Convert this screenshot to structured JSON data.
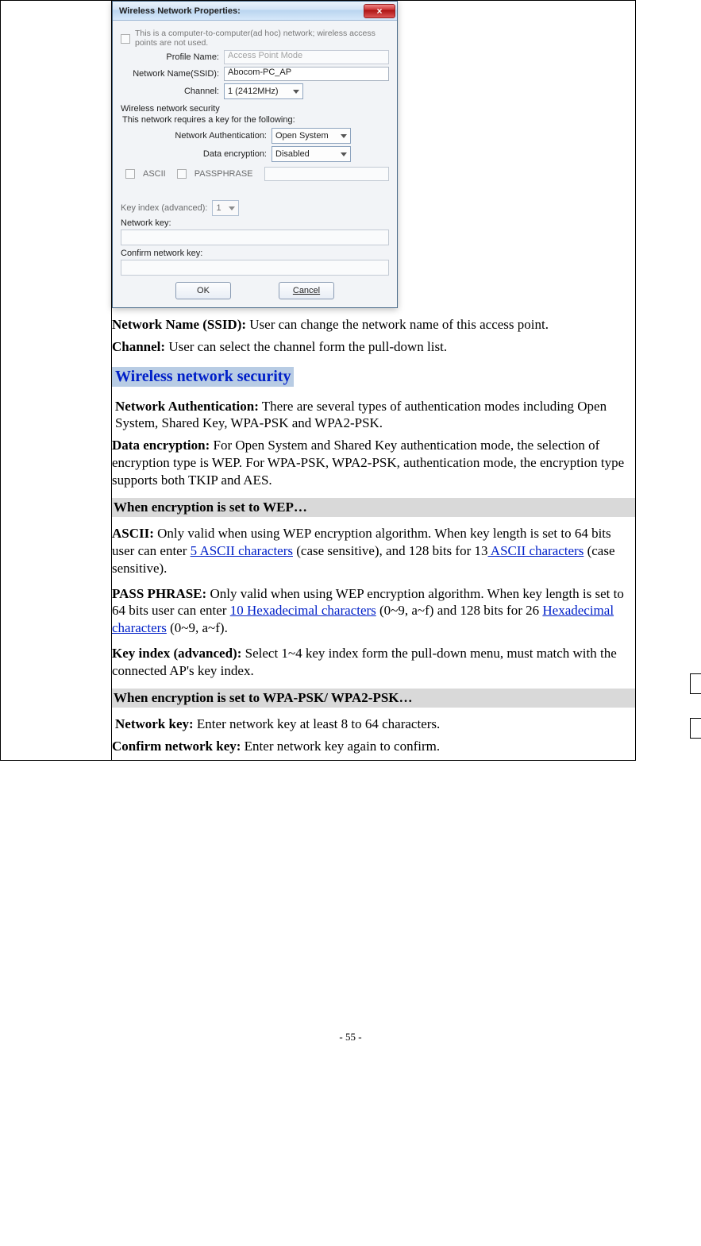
{
  "dialog": {
    "title": "Wireless Network Properties:",
    "adhoc_label": "This is a computer-to-computer(ad hoc) network; wireless access points are not used.",
    "profile_name_label": "Profile Name:",
    "profile_name_value": "Access Point Mode",
    "ssid_label": "Network Name(SSID):",
    "ssid_value": "Abocom-PC_AP",
    "channel_label": "Channel:",
    "channel_value": "1 (2412MHz)",
    "sec_group": "Wireless network security",
    "sec_sub": "This network requires a key for the following:",
    "auth_label": "Network Authentication:",
    "auth_value": "Open System",
    "enc_label": "Data encryption:",
    "enc_value": "Disabled",
    "ascii_label": "ASCII",
    "pass_label": "PASSPHRASE",
    "keyidx_label": "Key index (advanced):",
    "keyidx_value": "1",
    "netkey_label": "Network key:",
    "confirmkey_label": "Confirm network key:",
    "ok": "OK",
    "cancel": "Cancel"
  },
  "doc": {
    "ssid_b": "Network Name (SSID):",
    "ssid_t": " User can change the network name of this access point.",
    "channel_b": "Channel:",
    "channel_t": " User can select the channel form the pull-down list.",
    "sect_sec": "Wireless network security",
    "auth_b": "Network Authentication:",
    "auth_t": " There are several types of authentication modes including Open System, Shared Key, WPA-PSK and WPA2-PSK.",
    "enc_b": "Data encryption:",
    "enc_t": " For Open System and Shared Key authentication mode, the selection of encryption type is WEP. For WPA-PSK, WPA2-PSK, authentication mode, the encryption type supports both TKIP and AES.",
    "wep_h": "When encryption is set to WEP…",
    "ascii_b": "ASCII:",
    "ascii_t1": " Only valid when using WEP encryption algorithm. When key length is set to 64 bits user can enter ",
    "ascii_l1": "5 ASCII characters",
    "ascii_t2": " (case sensitive), and 128 bits for 13",
    "ascii_l2": " ASCII characters",
    "ascii_t3": " (case sensitive).",
    "pass_b": "PASS PHRASE:",
    "pass_t1": " Only valid when using WEP encryption algorithm. When key length is set to 64 bits user can enter ",
    "pass_l1": "10 Hexadecimal characters",
    "pass_t2": " (0~9, a~f) and 128 bits for 26 ",
    "pass_l2": "Hexadecimal characters",
    "pass_t3": " (0~9, a~f).",
    "kidx_b": "Key index (advanced):",
    "kidx_t": " Select 1~4 key index form the pull-down menu, must match with the connected AP's key index.",
    "wpa_h": "When encryption is set to WPA-PSK/ WPA2-PSK…",
    "nkey_b": "Network key:",
    "nkey_t": " Enter network key at least 8 to 64 characters.",
    "ckey_b": "Confirm network key:",
    "ckey_t": " Enter network key again to confirm.",
    "page_num": "- 55 -"
  }
}
